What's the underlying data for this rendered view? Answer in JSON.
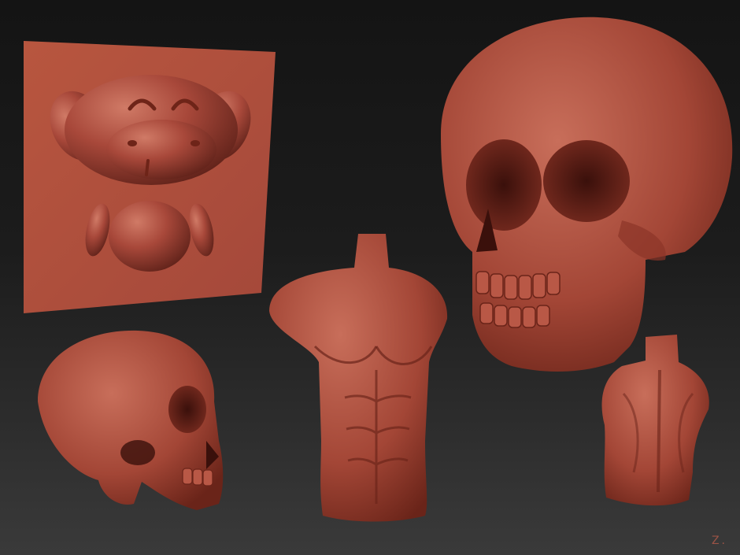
{
  "scene": {
    "background": "#1c1c1c",
    "clay_color": "#a8483a",
    "objects": [
      "relief-panel-cartoon-pig",
      "skull-front-large",
      "skull-side",
      "male-torso-front",
      "male-torso-back"
    ]
  },
  "signature": {
    "text": "Z.",
    "color": "#b45a4a"
  }
}
